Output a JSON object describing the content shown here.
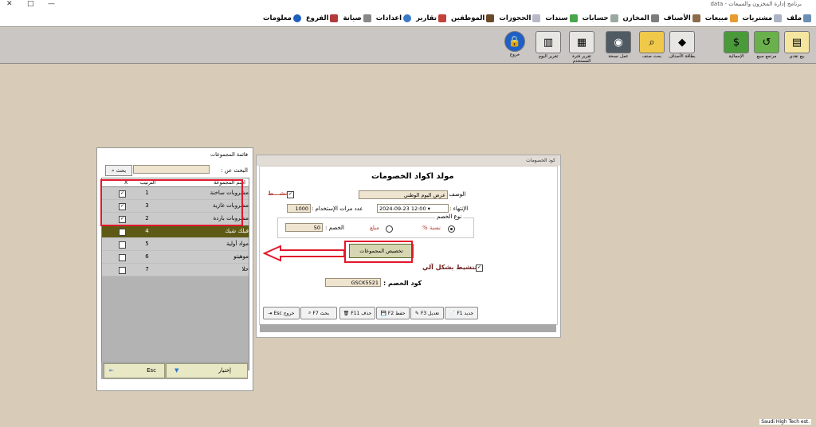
{
  "window": {
    "title": "برنامج إدارة المخزون والمبيعات - data",
    "controls": [
      "✕",
      "□",
      "—"
    ]
  },
  "menu": [
    "ملف",
    "مشتريات",
    "مبيعات",
    "الأصناف",
    "المخازن",
    "حسابات",
    "سندات",
    "الحجوزات",
    "الموظفين",
    "تقارير",
    "اعدادات",
    "صيانة",
    "الفروع",
    "معلومات"
  ],
  "toolbar": [
    "بيع نقدي",
    "مرتجع مبيع",
    "الإجمالية",
    "بطاقة الأصناف",
    "بحث صنف",
    "عمل نسخة",
    "تقرير فترة المستخدم",
    "تقرير اليوم",
    "خروج"
  ],
  "discount": {
    "window_title": "كود الخصومات",
    "heading": "مولد اكواد الخصومات",
    "desc_label": "الوصف :",
    "desc_value": "عرض اليوم الوطني",
    "active_label": "نشـــط",
    "expiry_label": "الإنتهاء :",
    "expiry_value": "2024-09-23 12:00",
    "uses_label": "عدد مرات الإستخدام :",
    "uses_value": "1000",
    "type_group": "نوع الخصم",
    "type_percent": "نسبة %",
    "type_amount": "مبلغ",
    "discount_label": "الخصم :",
    "discount_value": "50",
    "assign_button": "تخصيص المجموعات",
    "auto_label": "تنشيط بشكل آلي",
    "code_label": "كود الخصم :",
    "code_value": "GSCK5521",
    "buttons": {
      "new": "جديد F1",
      "edit": "تعديل F3",
      "save": "حفظ F2",
      "delete": "حذف F11",
      "search": "بحث F7",
      "exit": "خروج Esc"
    }
  },
  "groups": {
    "title": "قائمة المجموعات",
    "search_label": "البحث عن :",
    "search_button": "بحث",
    "col_name": "اسم المجموعة",
    "col_order": "الترتيب",
    "col_x": "X",
    "rows": [
      {
        "name": "مشروبات ساخنة",
        "order": "1",
        "checked": true
      },
      {
        "name": "مشروبات غازية",
        "order": "3",
        "checked": true
      },
      {
        "name": "مشروبات باردة",
        "order": "2",
        "checked": true
      },
      {
        "name": "فيلك شيك",
        "order": "4",
        "checked": false
      },
      {
        "name": "مواد أولية",
        "order": "5",
        "checked": false
      },
      {
        "name": "موهيتو",
        "order": "6",
        "checked": false
      },
      {
        "name": "حلا",
        "order": "7",
        "checked": false
      }
    ],
    "choose_button": "إختيار",
    "esc_button": "Esc"
  },
  "status": "Saudi High Tech est."
}
